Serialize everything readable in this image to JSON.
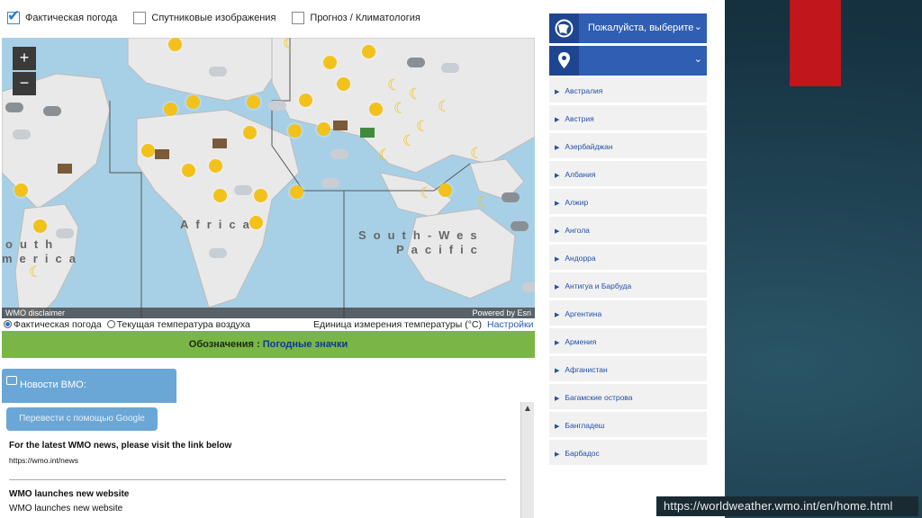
{
  "filters": [
    {
      "label": "Фактическая погода",
      "checked": true
    },
    {
      "label": "Спутниковые изображения",
      "checked": false
    },
    {
      "label": "Прогноз / Климатология",
      "checked": false
    }
  ],
  "map": {
    "zoom_in": "+",
    "zoom_out": "−",
    "labels": {
      "africa": "Africa",
      "south_america_1": "outh",
      "south_america_2": "merica",
      "sw_pacific_1": "South-Wes",
      "sw_pacific_2": "Pacific"
    },
    "disclaimer": "WMO disclaimer",
    "powered_by": "Powered by Esri",
    "background_color": "#a7d0e6",
    "land_color": "#e9e9e9"
  },
  "display_options": {
    "radio1": "Фактическая погода",
    "radio2": "Текущая температура воздуха",
    "unit_label": "Единица измерения температуры (°C)",
    "settings": "Настройки"
  },
  "legend": {
    "prefix": "Обозначения :",
    "link": "Погодные значки"
  },
  "news": {
    "tab_title": "Новости ВМО:",
    "translate_button": "Перевести с помощью Google",
    "item1_title": "For the latest WMO news, please visit the link below",
    "item1_link": "https://wmo.int/news",
    "item2_title": "WMO launches new website",
    "item2_text": "WMO launches new website"
  },
  "sidebar": {
    "country_select": "Пожалуйста, выберите",
    "countries": [
      "Австралия",
      "Австрия",
      "Азербайджан",
      "Албания",
      "Алжир",
      "Ангола",
      "Андорра",
      "Антигуа и Барбуда",
      "Аргентина",
      "Армения",
      "Афганистан",
      "Багамские острова",
      "Бангладеш",
      "Барбадос"
    ]
  },
  "caption": "https://worldweather.wmo.int/en/home.html",
  "colors": {
    "accent_blue": "#2f5eb3",
    "legend_green": "#7ab548",
    "slide_red": "#c0161c"
  }
}
